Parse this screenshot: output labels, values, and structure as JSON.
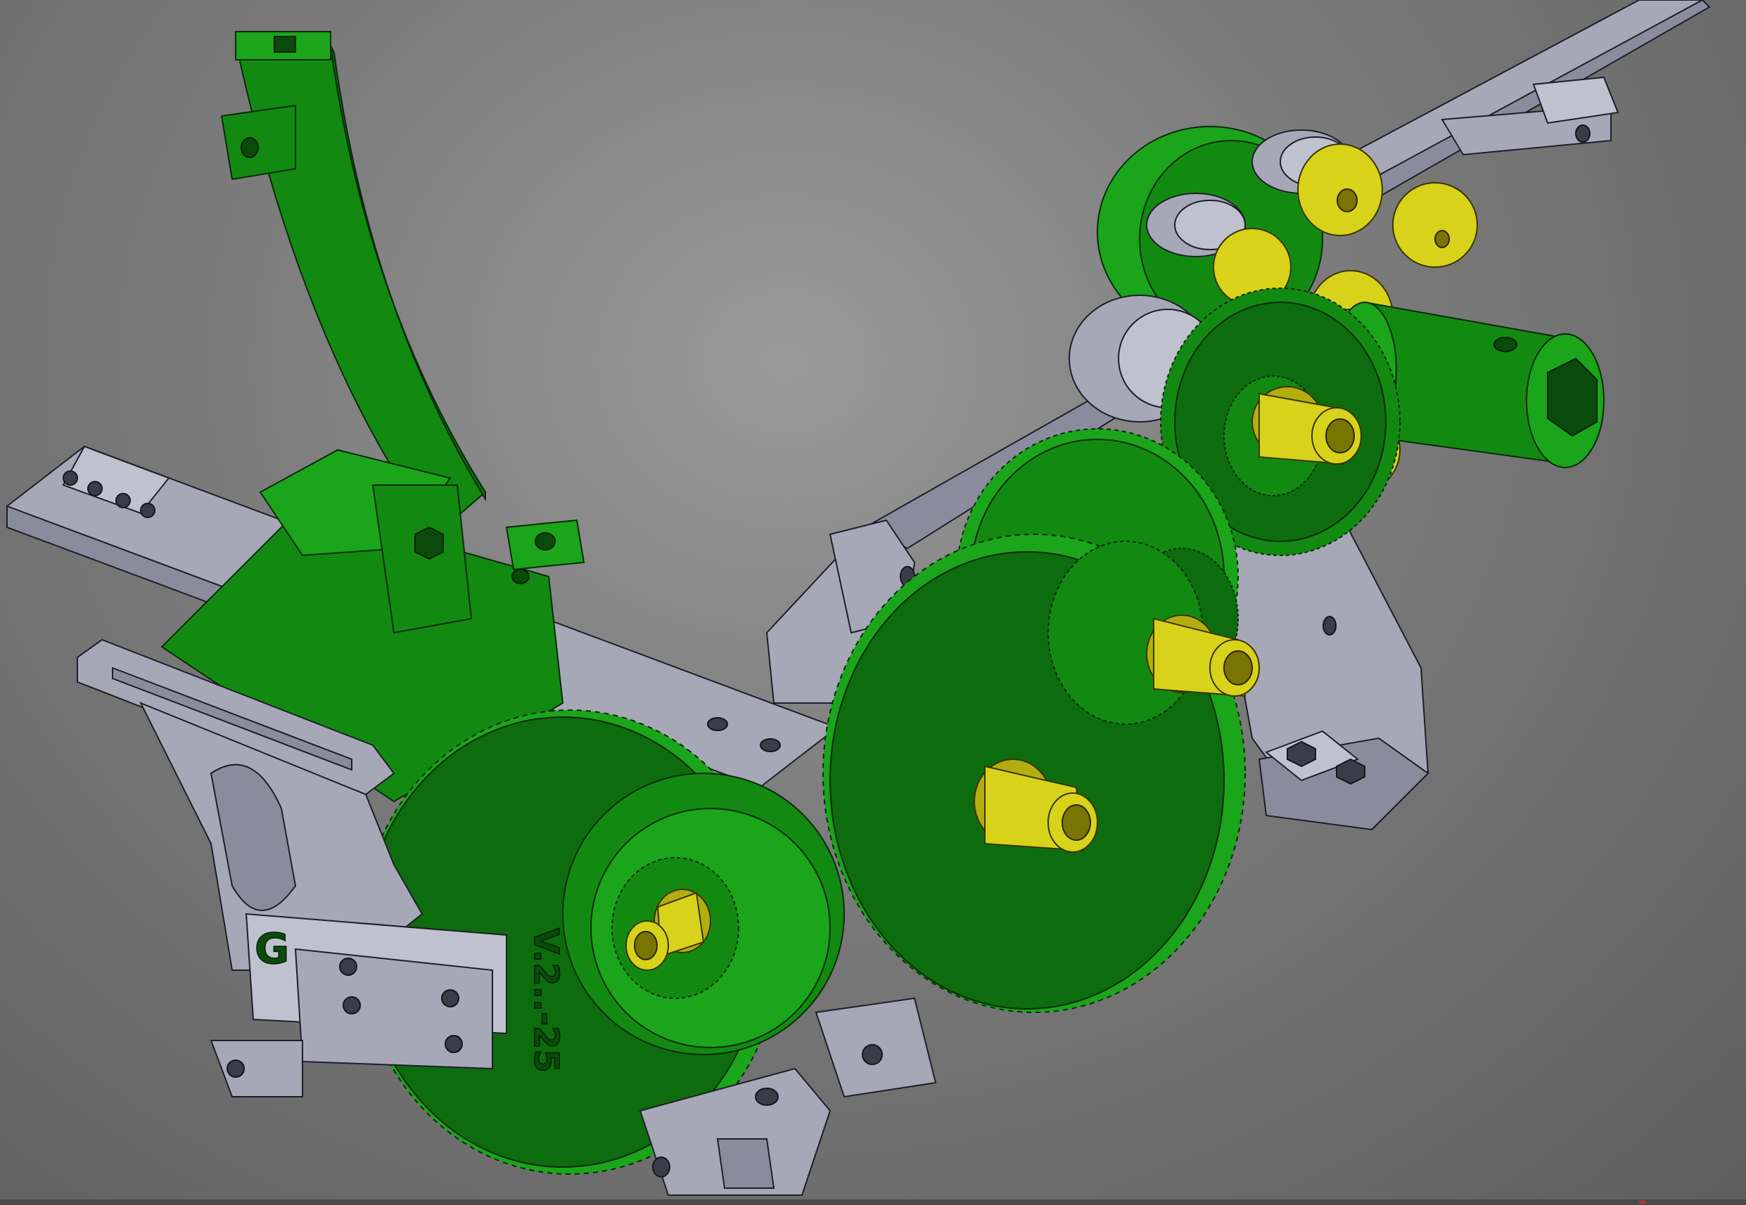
{
  "viewport": {
    "background_center": "#9a9a9a",
    "background_edge": "#5e5e5e"
  },
  "colors": {
    "green_part": "#128a12",
    "gray_part": "#a6a8b8",
    "yellow_part": "#d8d21a"
  },
  "engravings": {
    "version_text": "V.2..-25",
    "block_glyph": "G"
  },
  "icons": {
    "status_indicator": "red-dot-icon"
  }
}
